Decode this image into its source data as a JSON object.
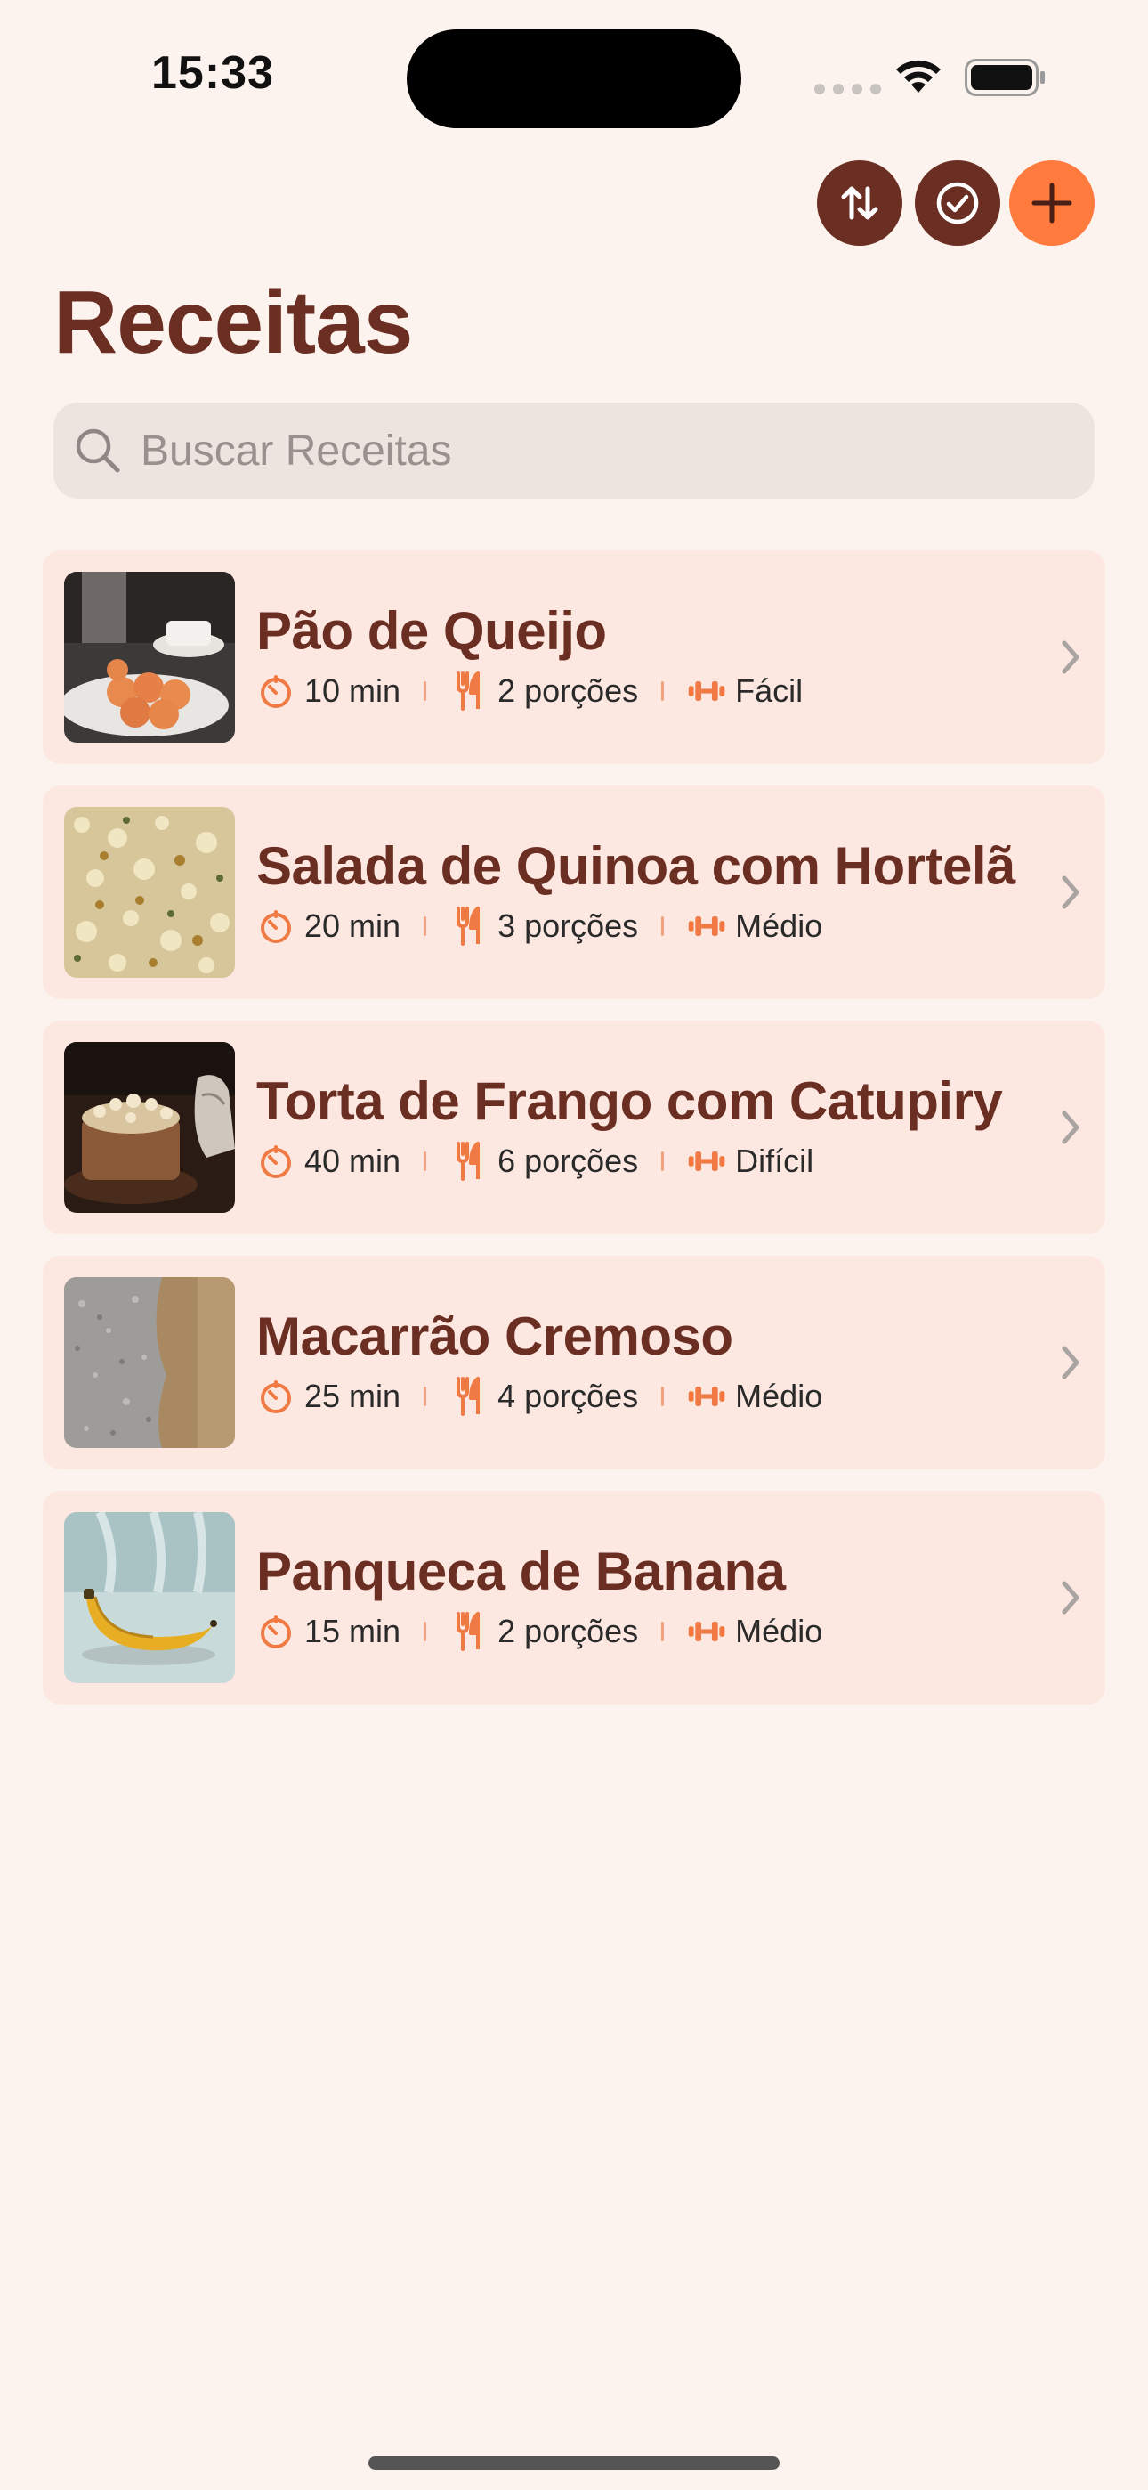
{
  "status_bar": {
    "time": "15:33"
  },
  "toolbar": {
    "sort_icon": "arrow-up-down-icon",
    "select_icon": "checkmark-circle-icon",
    "add_icon": "plus-icon"
  },
  "title": "Receitas",
  "search": {
    "placeholder": "Buscar Receitas",
    "value": ""
  },
  "colors": {
    "background": "#FDF3EE",
    "card": "#FDE8E1",
    "brand_dark": "#6B2E22",
    "accent": "#FF7A3D"
  },
  "recipes": [
    {
      "name": "Pão de Queijo",
      "time": "10 min",
      "servings": "2 porções",
      "difficulty": "Fácil"
    },
    {
      "name": "Salada de Quinoa com Hortelã",
      "time": "20 min",
      "servings": "3 porções",
      "difficulty": "Médio"
    },
    {
      "name": "Torta de Frango com Catupiry",
      "time": "40 min",
      "servings": "6 porções",
      "difficulty": "Difícil"
    },
    {
      "name": "Macarrão Cremoso",
      "time": "25 min",
      "servings": "4 porções",
      "difficulty": "Médio"
    },
    {
      "name": "Panqueca de Banana",
      "time": "15 min",
      "servings": "2 porções",
      "difficulty": "Médio"
    }
  ]
}
